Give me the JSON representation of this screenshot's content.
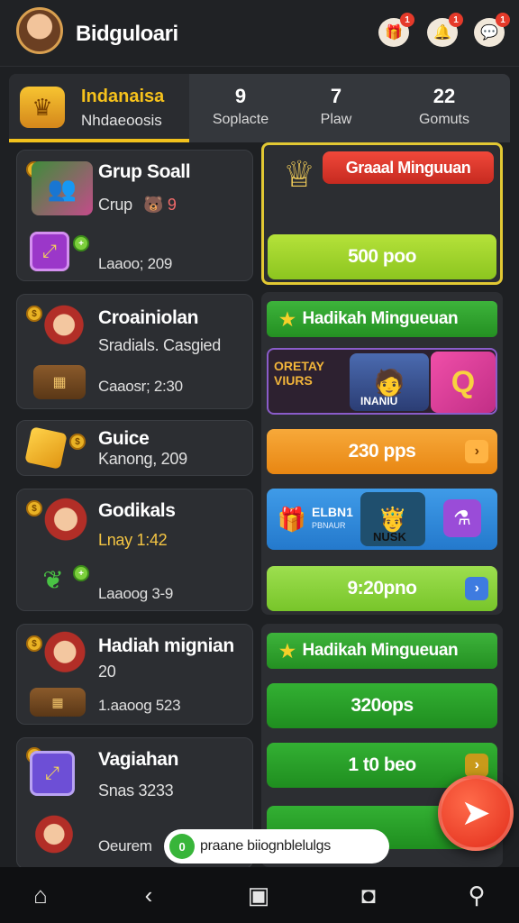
{
  "header": {
    "title": "Bidguloari",
    "icons": [
      {
        "name": "gift-icon",
        "badge": "1"
      },
      {
        "name": "bell-icon",
        "badge": "1"
      },
      {
        "name": "chat-icon",
        "badge": "1"
      }
    ]
  },
  "tabs": {
    "active": {
      "title": "Indanaisa",
      "subtitle": "Nhdaeoosis"
    },
    "items": [
      {
        "num": "9",
        "label": "Soplacte"
      },
      {
        "num": "7",
        "label": "Plaw"
      },
      {
        "num": "22",
        "label": "Gomuts"
      }
    ]
  },
  "left_list": [
    {
      "title": "Grup Soall",
      "sub": "Crup",
      "sub_icon": "🐻 9",
      "meta": "Laaoo; 209"
    },
    {
      "title": "Croainiolan",
      "sub": "Sradials. Casgied",
      "meta": "Caaosr; 2:30"
    },
    {
      "title": "Guice",
      "sub": "Kanong, 209"
    },
    {
      "title": "Godikals",
      "sub": "Lnay 1:42",
      "meta": "Laaoog 3-9"
    },
    {
      "title": "Hadiah mignian",
      "sub": "20",
      "meta": "1.aaoog 523"
    },
    {
      "title": "Vagiahan",
      "sub": "Snas 3233",
      "meta": "Oeurem"
    }
  ],
  "right": {
    "promo_banner": "Graaal Minguuan",
    "promo_button": "500 poo",
    "green_header_1": "Hadikah Mingueuan",
    "banner_1": {
      "left_text": "ORETAY VIURS",
      "caption": "INANIU",
      "badge": "Q"
    },
    "orange_pill": "230 pps",
    "banner_2": {
      "left_text": "ELBN1",
      "left_sub": "PBNAUR",
      "caption": "NUSK"
    },
    "lime_pill": "9:20pno",
    "green_header_2": "Hadikah Mingueuan",
    "green_pill_1": "320ops",
    "green_pill_2": "1 t0 beo"
  },
  "toast": {
    "text": "praane biiognblelulgs",
    "icon": "0"
  },
  "colors": {
    "accent_gold": "#f2c21d",
    "green": "#2ea52c",
    "orange": "#f49a1e",
    "lime": "#8fd33c",
    "red": "#e22d1b"
  }
}
